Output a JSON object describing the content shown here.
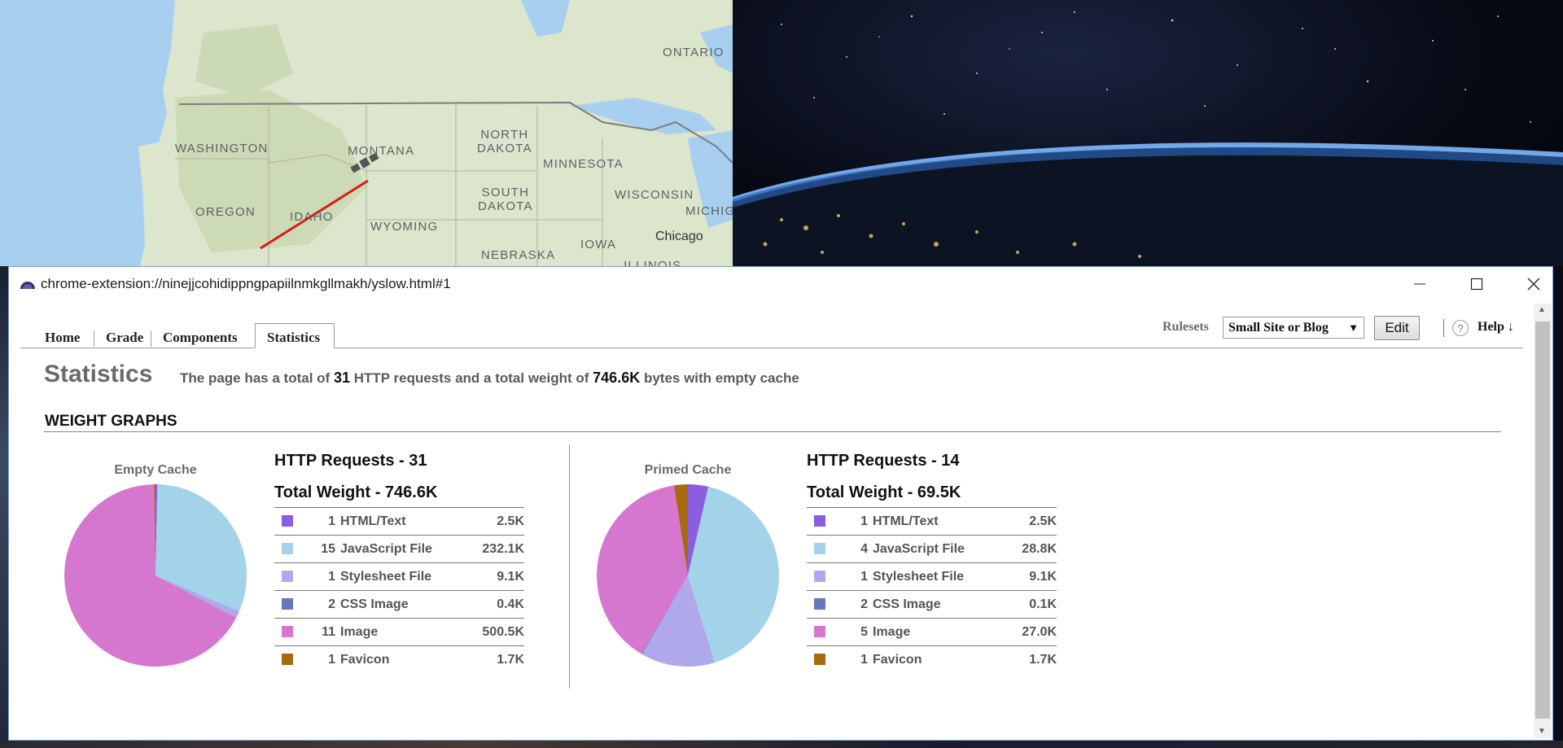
{
  "map": {
    "labels": [
      "ONTARIO",
      "WASHINGTON",
      "MONTANA",
      "NORTH\nDAKOTA",
      "MINNESOTA",
      "OREGON",
      "IDAHO",
      "SOUTH\nDAKOTA",
      "WISCONSIN",
      "MICHIG",
      "WYOMING",
      "IOWA",
      "Chicago",
      "NEBRASKA",
      "ILLINOIS"
    ]
  },
  "window": {
    "title": "chrome-extension://ninejjcohidippngpapiilnmkgllmakh/yslow.html#1"
  },
  "tabs": [
    {
      "label": "Home",
      "active": false
    },
    {
      "label": "Grade",
      "active": false
    },
    {
      "label": "Components",
      "active": false
    },
    {
      "label": "Statistics",
      "active": true
    }
  ],
  "toolbar": {
    "rulesets_label": "Rulesets",
    "rulesets_value": "Small Site or Blog",
    "edit_label": "Edit",
    "help_label": "Help ↓",
    "help_icon": "?"
  },
  "content": {
    "heading": "Statistics",
    "summary_prefix": "The page has a total of",
    "summary_requests": "31",
    "summary_mid": "HTTP requests and a total weight of",
    "summary_weight": "746.6K",
    "summary_suffix": "bytes with empty cache",
    "weight_graphs_title": "WEIGHT GRAPHS"
  },
  "colors": {
    "html": "#8b5ee0",
    "js": "#a3d3e8",
    "css": "#b0a8ec",
    "cssimg": "#6678b8",
    "image": "#d677cf",
    "favicon": "#a86a10"
  },
  "empty_cache": {
    "label": "Empty Cache",
    "requests_line": "HTTP Requests - 31",
    "weight_line": "Total Weight - 746.6K",
    "rows": [
      {
        "count": "1",
        "type": "HTML/Text",
        "value": "2.5K",
        "color": "#8b5ee0"
      },
      {
        "count": "15",
        "type": "JavaScript File",
        "value": "232.1K",
        "color": "#a3d3e8"
      },
      {
        "count": "1",
        "type": "Stylesheet File",
        "value": "9.1K",
        "color": "#b0a8ec"
      },
      {
        "count": "2",
        "type": "CSS Image",
        "value": "0.4K",
        "color": "#6678b8"
      },
      {
        "count": "11",
        "type": "Image",
        "value": "500.5K",
        "color": "#d677cf"
      },
      {
        "count": "1",
        "type": "Favicon",
        "value": "1.7K",
        "color": "#a86a10"
      }
    ]
  },
  "primed_cache": {
    "label": "Primed Cache",
    "requests_line": "HTTP Requests - 14",
    "weight_line": "Total Weight - 69.5K",
    "rows": [
      {
        "count": "1",
        "type": "HTML/Text",
        "value": "2.5K",
        "color": "#8b5ee0"
      },
      {
        "count": "4",
        "type": "JavaScript File",
        "value": "28.8K",
        "color": "#a3d3e8"
      },
      {
        "count": "1",
        "type": "Stylesheet File",
        "value": "9.1K",
        "color": "#b0a8ec"
      },
      {
        "count": "2",
        "type": "CSS Image",
        "value": "0.1K",
        "color": "#6678b8"
      },
      {
        "count": "5",
        "type": "Image",
        "value": "27.0K",
        "color": "#d677cf"
      },
      {
        "count": "1",
        "type": "Favicon",
        "value": "1.7K",
        "color": "#a86a10"
      }
    ]
  },
  "chart_data": [
    {
      "type": "pie",
      "title": "Empty Cache",
      "categories": [
        "HTML/Text",
        "JavaScript File",
        "Stylesheet File",
        "CSS Image",
        "Image",
        "Favicon"
      ],
      "values": [
        2.5,
        232.1,
        9.1,
        0.4,
        500.5,
        1.7
      ],
      "colors": [
        "#8b5ee0",
        "#a3d3e8",
        "#b0a8ec",
        "#6678b8",
        "#d677cf",
        "#a86a10"
      ]
    },
    {
      "type": "pie",
      "title": "Primed Cache",
      "categories": [
        "HTML/Text",
        "JavaScript File",
        "Stylesheet File",
        "CSS Image",
        "Image",
        "Favicon"
      ],
      "values": [
        2.5,
        28.8,
        9.1,
        0.1,
        27.0,
        1.7
      ],
      "colors": [
        "#8b5ee0",
        "#a3d3e8",
        "#b0a8ec",
        "#6678b8",
        "#d677cf",
        "#a86a10"
      ]
    }
  ]
}
